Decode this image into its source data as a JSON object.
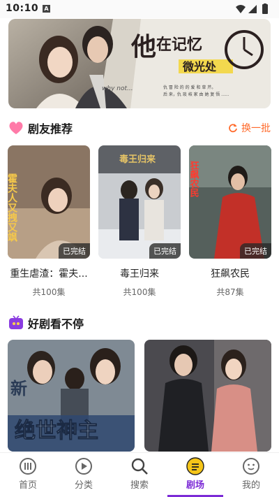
{
  "status_bar": {
    "time": "10:10",
    "notification_letter": "A"
  },
  "banner": {
    "title_main": "他",
    "title_part2": "在记忆",
    "title_part3": "微光处",
    "line1": "仇 冒 险 的 的 爱 和 草 芹。",
    "line2": "后 来，仇 琰 岐 家 由 她 复 悟 ......",
    "signature": "why not..."
  },
  "section_recommend": {
    "title": "剧友推荐",
    "refresh_label": "换一批",
    "cards": [
      {
        "title": "重生虐渣：霍夫...",
        "count": "共100集",
        "badge": "已完结",
        "poster_text": "霍夫人又拽又飒"
      },
      {
        "title": "毒王归来",
        "count": "共100集",
        "badge": "已完结",
        "poster_text": "毒王归来"
      },
      {
        "title": "狂飙农民",
        "count": "共87集",
        "badge": "已完结",
        "poster_text": "狂飙农民"
      }
    ]
  },
  "section_nonstop": {
    "title": "好剧看不停",
    "posters": [
      {
        "poster_text": "绝世神主",
        "tag": "新"
      },
      {
        "poster_text": ""
      }
    ]
  },
  "tabs": [
    {
      "label": "首页",
      "icon": "home-icon",
      "active": false
    },
    {
      "label": "分类",
      "icon": "category-icon",
      "active": false
    },
    {
      "label": "搜索",
      "icon": "search-icon",
      "active": false
    },
    {
      "label": "剧场",
      "icon": "theater-icon",
      "active": true
    },
    {
      "label": "我的",
      "icon": "profile-icon",
      "active": false
    }
  ],
  "colors": {
    "accent": "#7c2bd6",
    "refresh": "#ff6a2b",
    "theater_icon": "#f5c518"
  }
}
